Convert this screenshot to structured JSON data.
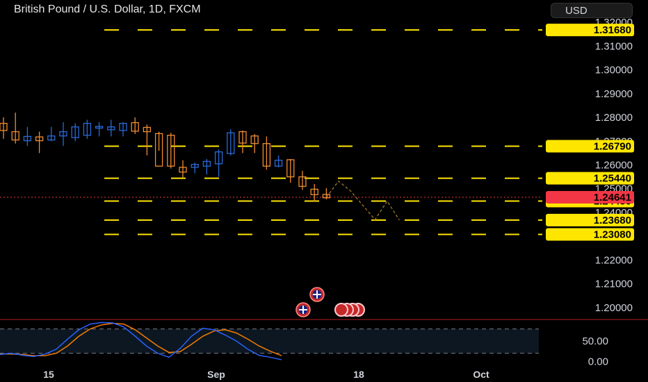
{
  "header": {
    "title": "British Pound / U.S. Dollar, 1D, FXCM",
    "currency_label": "USD"
  },
  "colors": {
    "background": "#000000",
    "bull_candle": "#2a6ad8",
    "bear_candle": "#f08c32",
    "level_line": "#ffe600",
    "level_tag": "#ffe600",
    "current_price_tag": "#f23645",
    "stoch_k": "#2962ff",
    "stoch_d": "#f57c00",
    "separator": "#b71c1c"
  },
  "chart_data": {
    "type": "candlestick",
    "title": "British Pound / U.S. Dollar, 1D, FXCM",
    "price_axis": {
      "ylim": [
        1.195,
        1.325
      ],
      "ticks": [
        "1.32000",
        "1.31000",
        "1.30000",
        "1.29000",
        "1.28000",
        "1.27000",
        "1.26000",
        "1.25000",
        "1.24000",
        "1.23000",
        "1.22000",
        "1.21000",
        "1.20000"
      ]
    },
    "x_axis": {
      "tick_labels": [
        "15",
        "Sep",
        "18",
        "Oct"
      ]
    },
    "candles": [
      {
        "o": 1.2775,
        "h": 1.28,
        "l": 1.271,
        "c": 1.2745
      },
      {
        "o": 1.274,
        "h": 1.282,
        "l": 1.269,
        "c": 1.2705
      },
      {
        "o": 1.2702,
        "h": 1.276,
        "l": 1.268,
        "c": 1.272
      },
      {
        "o": 1.2718,
        "h": 1.274,
        "l": 1.265,
        "c": 1.2702
      },
      {
        "o": 1.2705,
        "h": 1.276,
        "l": 1.27,
        "c": 1.2722
      },
      {
        "o": 1.2722,
        "h": 1.278,
        "l": 1.268,
        "c": 1.274
      },
      {
        "o": 1.2715,
        "h": 1.2775,
        "l": 1.27,
        "c": 1.276
      },
      {
        "o": 1.2725,
        "h": 1.279,
        "l": 1.271,
        "c": 1.2775
      },
      {
        "o": 1.2755,
        "h": 1.278,
        "l": 1.272,
        "c": 1.2762
      },
      {
        "o": 1.2748,
        "h": 1.279,
        "l": 1.272,
        "c": 1.276
      },
      {
        "o": 1.2745,
        "h": 1.278,
        "l": 1.272,
        "c": 1.2775
      },
      {
        "o": 1.2778,
        "h": 1.28,
        "l": 1.273,
        "c": 1.2742
      },
      {
        "o": 1.2758,
        "h": 1.277,
        "l": 1.264,
        "c": 1.274
      },
      {
        "o": 1.2732,
        "h": 1.274,
        "l": 1.266,
        "c": 1.2595
      },
      {
        "o": 1.2725,
        "h": 1.2735,
        "l": 1.2585,
        "c": 1.2595
      },
      {
        "o": 1.259,
        "h": 1.262,
        "l": 1.2545,
        "c": 1.257
      },
      {
        "o": 1.259,
        "h": 1.261,
        "l": 1.2565,
        "c": 1.2602
      },
      {
        "o": 1.2595,
        "h": 1.2625,
        "l": 1.256,
        "c": 1.2615
      },
      {
        "o": 1.2605,
        "h": 1.2665,
        "l": 1.255,
        "c": 1.2655
      },
      {
        "o": 1.2648,
        "h": 1.275,
        "l": 1.264,
        "c": 1.2735
      },
      {
        "o": 1.274,
        "h": 1.2745,
        "l": 1.265,
        "c": 1.2692
      },
      {
        "o": 1.2722,
        "h": 1.273,
        "l": 1.265,
        "c": 1.269
      },
      {
        "o": 1.269,
        "h": 1.272,
        "l": 1.258,
        "c": 1.2595
      },
      {
        "o": 1.2595,
        "h": 1.264,
        "l": 1.259,
        "c": 1.262
      },
      {
        "o": 1.2622,
        "h": 1.2625,
        "l": 1.2525,
        "c": 1.255
      },
      {
        "o": 1.255,
        "h": 1.2575,
        "l": 1.2495,
        "c": 1.251
      },
      {
        "o": 1.2498,
        "h": 1.252,
        "l": 1.2445,
        "c": 1.2475
      },
      {
        "o": 1.2476,
        "h": 1.2502,
        "l": 1.2455,
        "c": 1.2462
      }
    ],
    "levels": [
      {
        "value": 1.3168,
        "label": "1.31680"
      },
      {
        "value": 1.2679,
        "label": "1.26790"
      },
      {
        "value": 1.2544,
        "label": "1.25440"
      },
      {
        "value": 1.2448,
        "label": "1.24480"
      },
      {
        "value": 1.2368,
        "label": "1.23680"
      },
      {
        "value": 1.2308,
        "label": "1.23080"
      }
    ],
    "current_price": {
      "value": 1.24641,
      "label": "1.24641"
    },
    "projection": [
      1.24641,
      1.2532,
      1.249,
      1.243,
      1.237,
      1.2448,
      1.2368
    ],
    "oscillator": {
      "ylim": [
        -3,
        100
      ],
      "ticks": [
        "50.00",
        "0.00"
      ],
      "bands": [
        20,
        80
      ],
      "k": [
        17,
        20,
        15,
        12,
        18,
        30,
        55,
        78,
        92,
        96,
        95,
        85,
        62,
        38,
        20,
        10,
        32,
        62,
        82,
        78,
        65,
        50,
        30,
        15,
        10,
        4
      ],
      "d": [
        18,
        18,
        17,
        14,
        14,
        20,
        38,
        62,
        80,
        90,
        94,
        92,
        78,
        58,
        38,
        22,
        24,
        42,
        62,
        75,
        78,
        70,
        55,
        38,
        25,
        14
      ]
    }
  }
}
